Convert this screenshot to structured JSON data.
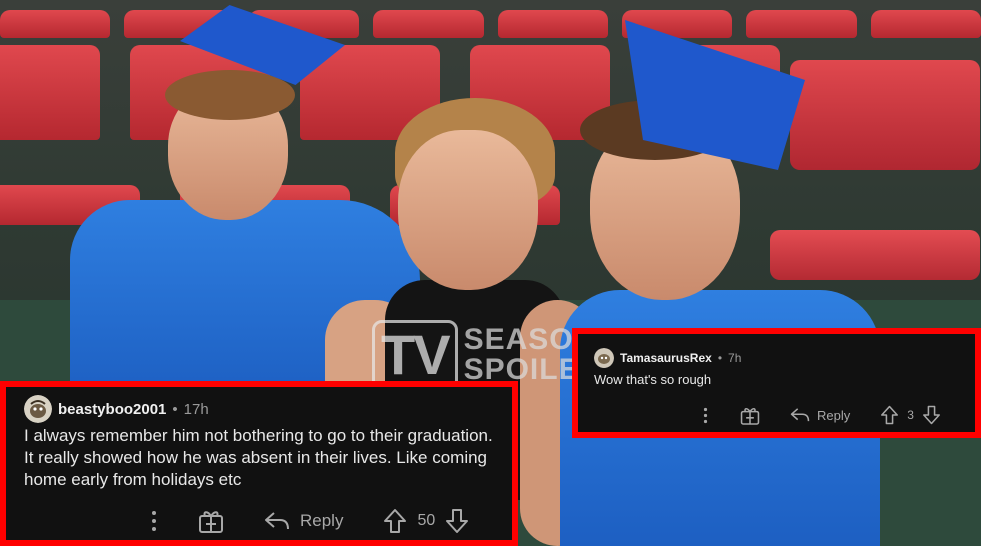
{
  "watermark": {
    "logo_text": "TV",
    "line1": "SEASON &",
    "line2": "SPOILERS"
  },
  "comments": [
    {
      "username": "beastyboo2001",
      "separator": "•",
      "time": "17h",
      "text": "I always remember him not bothering to go to their graduation. It really showed how he was absent in their lives. Like coming home early from holidays etc",
      "reply_label": "Reply",
      "votes": "50",
      "avatar_icon": "cartoon-avatar-icon"
    },
    {
      "username": "TamasaurusRex",
      "separator": "•",
      "time": "7h",
      "text": "Wow that's so rough",
      "reply_label": "Reply",
      "votes": "3",
      "avatar_icon": "cartoon-avatar-icon"
    }
  ],
  "colors": {
    "highlight_border": "#ff0000",
    "card_background": "#111111",
    "text": "#e6e6e6",
    "muted": "#a8a8a8"
  }
}
